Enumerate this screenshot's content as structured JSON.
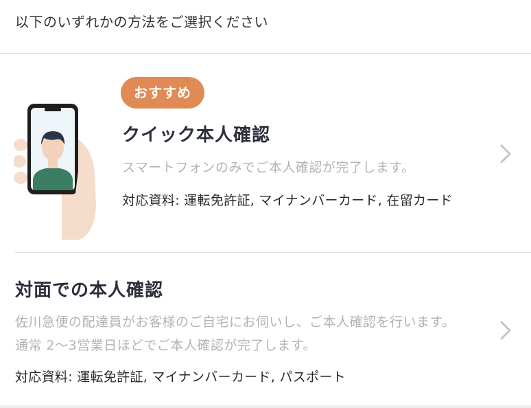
{
  "header": {
    "instruction": "以下のいずれかの方法をご選択ください"
  },
  "options": [
    {
      "badge": "おすすめ",
      "title": "クイック本人確認",
      "description": "スマートフォンのみでご本人確認が完了します。",
      "documents": "対応資料: 運転免許証, マイナンバーカード, 在留カード",
      "icon": "smartphone-selfie-illustration"
    },
    {
      "title": "対面での本人確認",
      "description": "佐川急便の配達員がお客様のご自宅にお伺いし、ご本人確認を行います。通常 2～3営業日ほどでご本人確認が完了します。",
      "documents": "対応資料: 運転免許証, マイナンバーカード, パスポート"
    }
  ],
  "colors": {
    "badge": "#e08a55",
    "title": "#2b2f3a",
    "muted_text": "#b3b3b3",
    "divider": "#e4e4e4",
    "chevron": "#c4c4c4"
  }
}
